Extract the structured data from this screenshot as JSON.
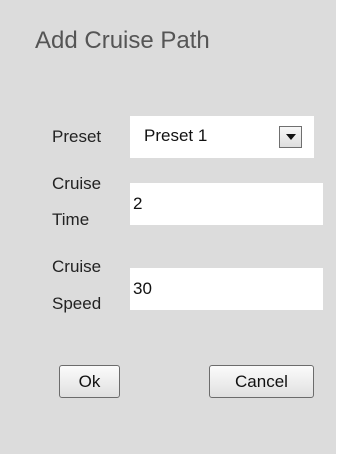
{
  "dialog": {
    "title": "Add Cruise Path"
  },
  "form": {
    "preset": {
      "label": "Preset",
      "selected": "Preset 1"
    },
    "cruise_time": {
      "label_line1": "Cruise",
      "label_line2": "Time",
      "value": "2"
    },
    "cruise_speed": {
      "label_line1": "Cruise",
      "label_line2": "Speed",
      "value": "30"
    }
  },
  "buttons": {
    "ok_label": "Ok",
    "cancel_label": "Cancel"
  },
  "colors": {
    "dialog_background": "#dcdcdc",
    "title_text": "#555555"
  },
  "icons": {
    "dropdown": "chevron-down-icon"
  }
}
